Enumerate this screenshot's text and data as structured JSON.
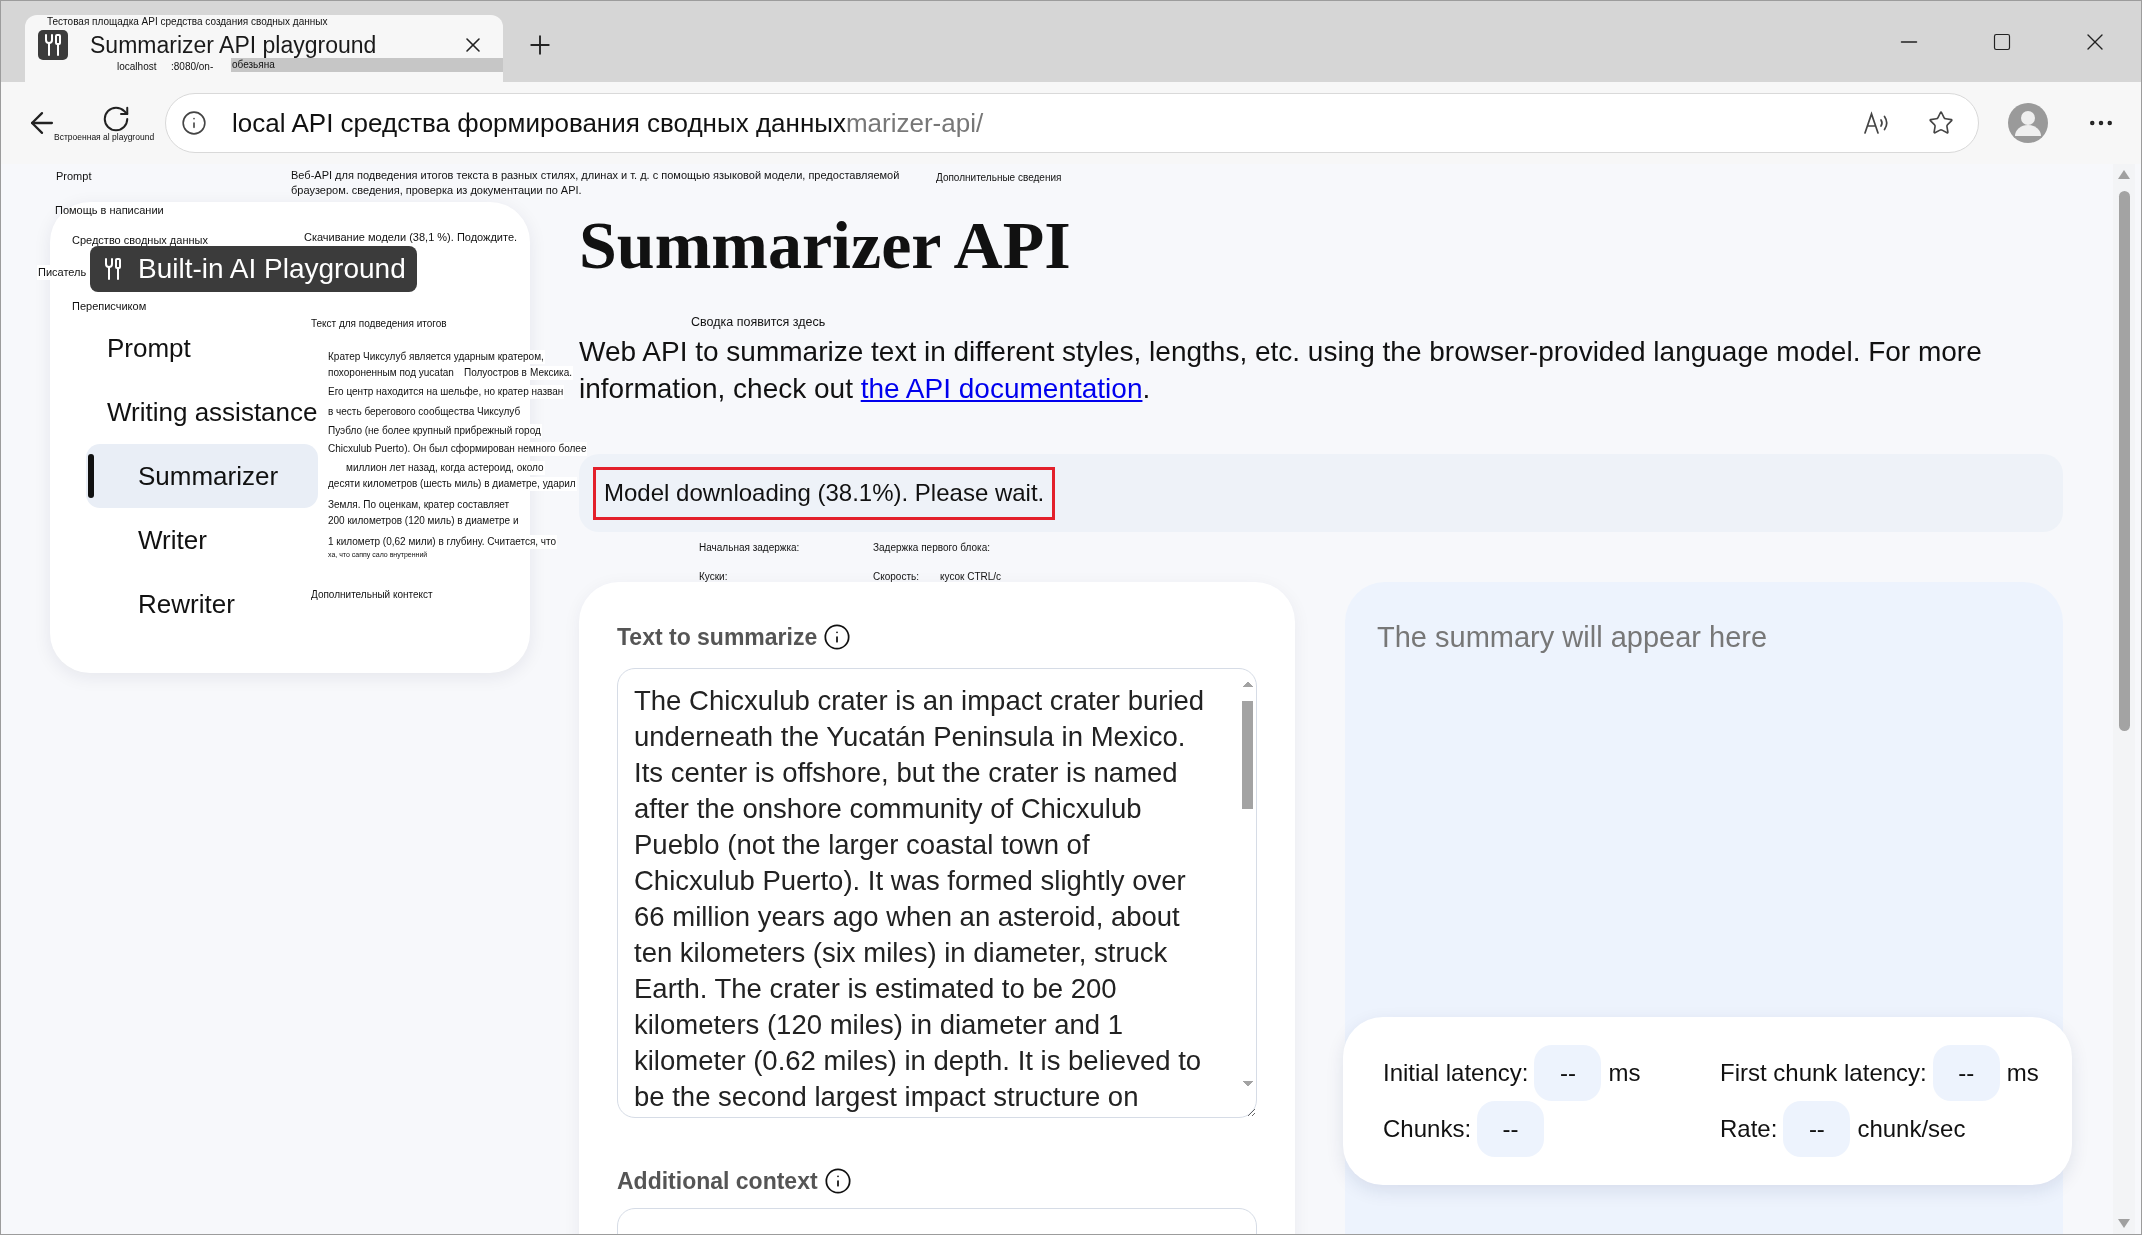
{
  "tabs": [
    {
      "title": "Summarizer API playground",
      "selected": true,
      "translation_overlay": [
        {
          "text": "Тестовая площадка API средства создания сводных данных",
          "kind": "label"
        },
        {
          "text": "localhost",
          "kind": "label"
        },
        {
          "text": ":8080/on-",
          "kind": "label"
        },
        {
          "text": "обезьяна",
          "kind": "bar"
        }
      ]
    }
  ],
  "address_bar": {
    "host": "local",
    "translation": "API средства формирования сводных данных",
    "path": "marizer-api/"
  },
  "sidebar": {
    "badge": "Built-in AI Playground",
    "items": [
      {
        "label": "Prompt",
        "selected": false
      },
      {
        "label": "Writing assistance",
        "selected": false,
        "children": [
          {
            "label": "Summarizer",
            "selected": true
          },
          {
            "label": "Writer",
            "selected": false
          },
          {
            "label": "Rewriter",
            "selected": false
          }
        ]
      }
    ]
  },
  "main": {
    "title": "Summarizer API",
    "description": {
      "text": "Web API to summarize text in different styles, lengths, etc. using the browser-provided language model. For more information, check out ",
      "link": "the API documentation",
      "end": "."
    },
    "status": "Model downloading (38.1%). Please wait.",
    "input_card": {
      "fields": [
        {
          "label": "Text to summarize",
          "value": "The Chicxulub crater is an impact crater buried underneath the Yucatán Peninsula in Mexico. Its center is offshore, but the crater is named after the onshore community of Chicxulub Pueblo (not the larger coastal town of Chicxulub Puerto). It was formed slightly over 66 million years ago when an asteroid, about ten kilometers (six miles) in diameter, struck Earth. The crater is estimated to be 200 kilometers (120 miles) in diameter and 1 kilometer (0.62 miles) in depth. It is believed to be the second largest impact structure on"
        },
        {
          "label": "Additional context"
        }
      ]
    },
    "output_card": {
      "placeholder": "The summary will appear here",
      "stats": [
        {
          "name": "Initial latency:",
          "reading": "--",
          "unit": "ms"
        },
        {
          "name": "First chunk latency:",
          "reading": "--",
          "unit": "ms"
        },
        {
          "name": "Chunks:",
          "reading": "--"
        },
        {
          "name": "Rate:",
          "reading": "--",
          "unit": "chunk/sec"
        }
      ]
    }
  },
  "translation_overlay": [
    {
      "text": "Встроенная al playground",
      "kind": "label"
    },
    {
      "text": "Prompt",
      "kind": "label"
    },
    {
      "text": "Веб-API для подведения итогов текста в разных стилях, длинах и т. д. с помощью языковой модели, предоставляемой браузером. сведения, проверка из документации по API.",
      "kind": "label"
    },
    {
      "text": "Дополнительные сведения",
      "kind": "label"
    },
    {
      "text": "Помощь в написании",
      "kind": "label"
    },
    {
      "text": "Средство сводных данных",
      "kind": "label"
    },
    {
      "text": "Скачивание модели (38,1 %). Подождите.",
      "kind": "line"
    },
    {
      "text": "Писатель",
      "kind": "line"
    },
    {
      "text": "Переписчиком",
      "kind": "label"
    },
    {
      "text": "Текст для подведения итогов",
      "kind": "label"
    },
    {
      "text": "Сводка появится здесь",
      "kind": "label"
    },
    {
      "text": "Кратер Чиксулуб является ударным кратером,",
      "kind": "line"
    },
    {
      "text": "похороненным под yucatan",
      "kind": "line"
    },
    {
      "text": "Полуостров в",
      "kind": "line"
    },
    {
      "text": "Мексика.",
      "kind": "line"
    },
    {
      "text": "Его центр находится на шельфе, но кратер назван",
      "kind": "line"
    },
    {
      "text": "в честь берегового сообщества Чиксулуб",
      "kind": "line"
    },
    {
      "text": "Пуэбло (не более крупный прибрежный город",
      "kind": "line"
    },
    {
      "text": "Chicxulub Puerto). Он был сформирован немного более",
      "kind": "line"
    },
    {
      "text": "миллион лет назад, когда астероид, около",
      "kind": "line"
    },
    {
      "text": "десяти километров (шесть миль) в диаметре, ударил",
      "kind": "line"
    },
    {
      "text": "Земля. По оценкам, кратер составляет",
      "kind": "line"
    },
    {
      "text": "200 километров (120 миль) в диаметре и",
      "kind": "line"
    },
    {
      "text": "1 километр (0,62 мили) в глубину. Считается, что",
      "kind": "line"
    },
    {
      "text": "ха, что саппу сало внутренний",
      "kind": "label"
    },
    {
      "text": "Начальная задержка:",
      "kind": "label"
    },
    {
      "text": "Задержка первого блока:",
      "kind": "label"
    },
    {
      "text": "Куски:",
      "kind": "label"
    },
    {
      "text": "Скорость:",
      "kind": "label"
    },
    {
      "text": "кусок CTRL/c",
      "kind": "label"
    },
    {
      "text": "Дополнительный контекст",
      "kind": "label"
    }
  ]
}
